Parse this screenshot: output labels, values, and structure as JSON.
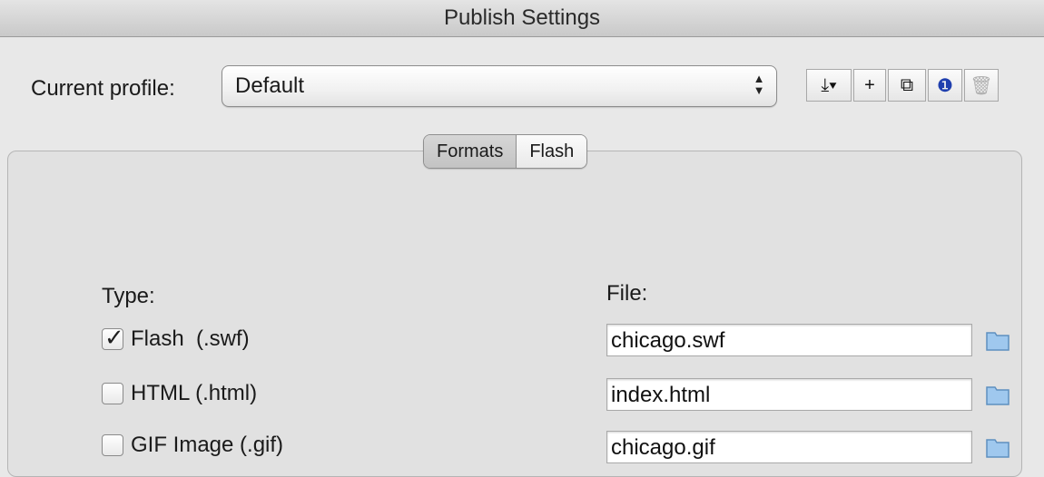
{
  "window": {
    "title": "Publish Settings"
  },
  "profile": {
    "label": "Current profile:",
    "selected": "Default"
  },
  "toolbar": {
    "buttons": [
      {
        "icon": "import-export-icon",
        "glyph": "⤓▾"
      },
      {
        "icon": "add-icon",
        "glyph": "+"
      },
      {
        "icon": "duplicate-icon",
        "glyph": "⧉"
      },
      {
        "icon": "info-icon",
        "glyph": "❶"
      },
      {
        "icon": "trash-icon",
        "glyph": "🗑"
      }
    ]
  },
  "tabs": [
    {
      "label": "Formats",
      "active": true
    },
    {
      "label": "Flash",
      "active": false
    }
  ],
  "formats": {
    "type_header": "Type:",
    "file_header": "File:",
    "rows": [
      {
        "label": "Flash  (.swf)",
        "checked": true,
        "file": "chicago.swf"
      },
      {
        "label": "HTML (.html)",
        "checked": false,
        "file": "index.html"
      },
      {
        "label": "GIF Image (.gif)",
        "checked": false,
        "file": "chicago.gif"
      }
    ]
  },
  "colors": {
    "folder_fill": "#9fc8ee",
    "folder_stroke": "#5e8fbf",
    "info_blue": "#1f3fae"
  }
}
